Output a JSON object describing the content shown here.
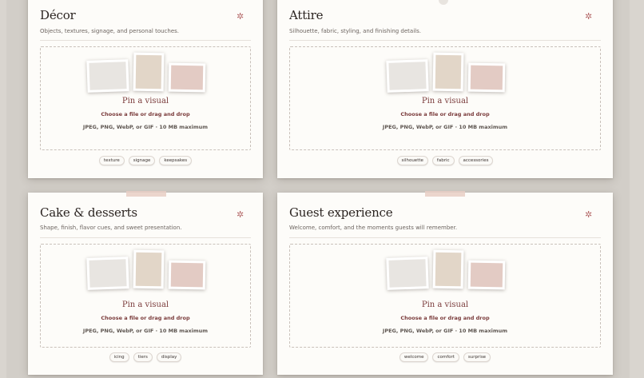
{
  "cards": [
    {
      "title": "Décor",
      "subtitle": "Objects, textures, signage, and personal touches.",
      "pin_title": "Pin a visual",
      "choose": "Choose a file or drag and drop",
      "formats": "JPEG, PNG, WebP, or GIF · 10 MB maximum",
      "tags": [
        "texture",
        "signage",
        "keepsakes"
      ]
    },
    {
      "title": "Attire",
      "subtitle": "Silhouette, fabric, styling, and finishing details.",
      "pin_title": "Pin a visual",
      "choose": "Choose a file or drag and drop",
      "formats": "JPEG, PNG, WebP, or GIF · 10 MB maximum",
      "tags": [
        "silhouette",
        "fabric",
        "accessories"
      ]
    },
    {
      "title": "Cake & desserts",
      "subtitle": "Shape, finish, flavor cues, and sweet presentation.",
      "pin_title": "Pin a visual",
      "choose": "Choose a file or drag and drop",
      "formats": "JPEG, PNG, WebP, or GIF · 10 MB maximum",
      "tags": [
        "icing",
        "tiers",
        "display"
      ]
    },
    {
      "title": "Guest experience",
      "subtitle": "Welcome, comfort, and the moments guests will remember.",
      "pin_title": "Pin a visual",
      "choose": "Choose a file or drag and drop",
      "formats": "JPEG, PNG, WebP, or GIF · 10 MB maximum",
      "tags": [
        "welcome",
        "comfort",
        "surprise"
      ]
    }
  ],
  "icons": {
    "card_action": "sparkle-icon"
  },
  "colors": {
    "accent": "#7a3b3b",
    "sparkle": "#b56a6a",
    "swatch_gray": "#e8e5e1",
    "swatch_beige": "#e2d6c8",
    "swatch_rose": "#e3cbc4"
  }
}
